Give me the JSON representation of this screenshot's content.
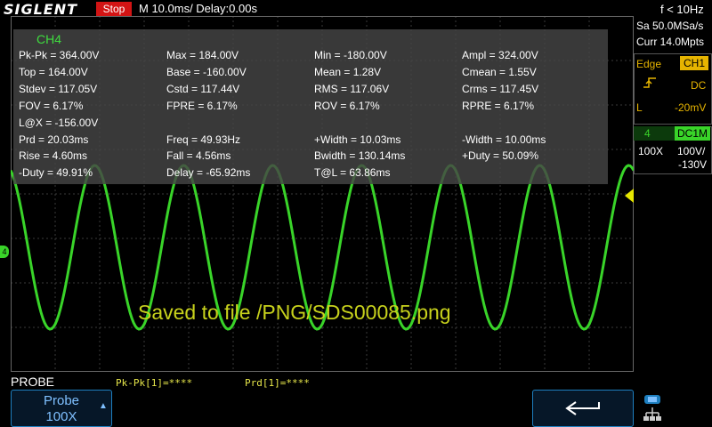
{
  "header": {
    "brand": "SIGLENT",
    "run_state": "Stop",
    "timebase": "M 10.0ms/ Delay:0.00s"
  },
  "measurements": {
    "channel": "CH4",
    "rows": [
      [
        "Pk-Pk = 364.00V",
        "Max = 184.00V",
        "Min = -180.00V",
        "Ampl = 324.00V"
      ],
      [
        "Top = 164.00V",
        "Base = -160.00V",
        "Mean = 1.28V",
        "Cmean = 1.55V"
      ],
      [
        "Stdev = 117.05V",
        "Cstd = 117.44V",
        "RMS = 117.06V",
        "Crms = 117.45V"
      ],
      [
        "FOV = 6.17%",
        "FPRE = 6.17%",
        "ROV = 6.17%",
        "RPRE = 6.17%"
      ],
      [
        "L@X = -156.00V",
        "",
        "",
        ""
      ],
      [
        "Prd = 20.03ms",
        "Freq = 49.93Hz",
        "+Width = 10.03ms",
        "-Width = 10.00ms"
      ],
      [
        "Rise = 4.60ms",
        "Fall = 4.56ms",
        "Bwidth = 130.14ms",
        "+Duty = 50.09%"
      ],
      [
        "-Duty = 49.91%",
        "Delay = -65.92ms",
        "T@L = 63.86ms",
        ""
      ]
    ]
  },
  "message": "Saved to file /PNG/SDS00085.png",
  "channel_marker": "4",
  "right_panel": {
    "freq": "f < 10Hz",
    "sample_rate": "Sa 50.0MSa/s",
    "memory": "Curr 14.0Mpts",
    "trigger": {
      "type": "Edge",
      "source": "CH1",
      "coupling": "DC",
      "level_label": "L",
      "level": "-20mV"
    },
    "channel": {
      "number": "4",
      "coupling": "DC1M",
      "probe": "100X",
      "scale": "100V/",
      "offset": "-130V"
    }
  },
  "bottom": {
    "menu_title": "PROBE",
    "probe_label": "Probe",
    "probe_value": "100X",
    "stat1": "Pk-Pk[1]=****",
    "stat2": "Prd[1]=****"
  },
  "colors": {
    "trace": "#39d429",
    "trigger": "#e6b400",
    "accent": "#1e7fbf",
    "stop": "#d21414"
  },
  "waveform": {
    "periods_on_screen": 7,
    "y_max_div": 1.15,
    "phase_deg": 110
  }
}
